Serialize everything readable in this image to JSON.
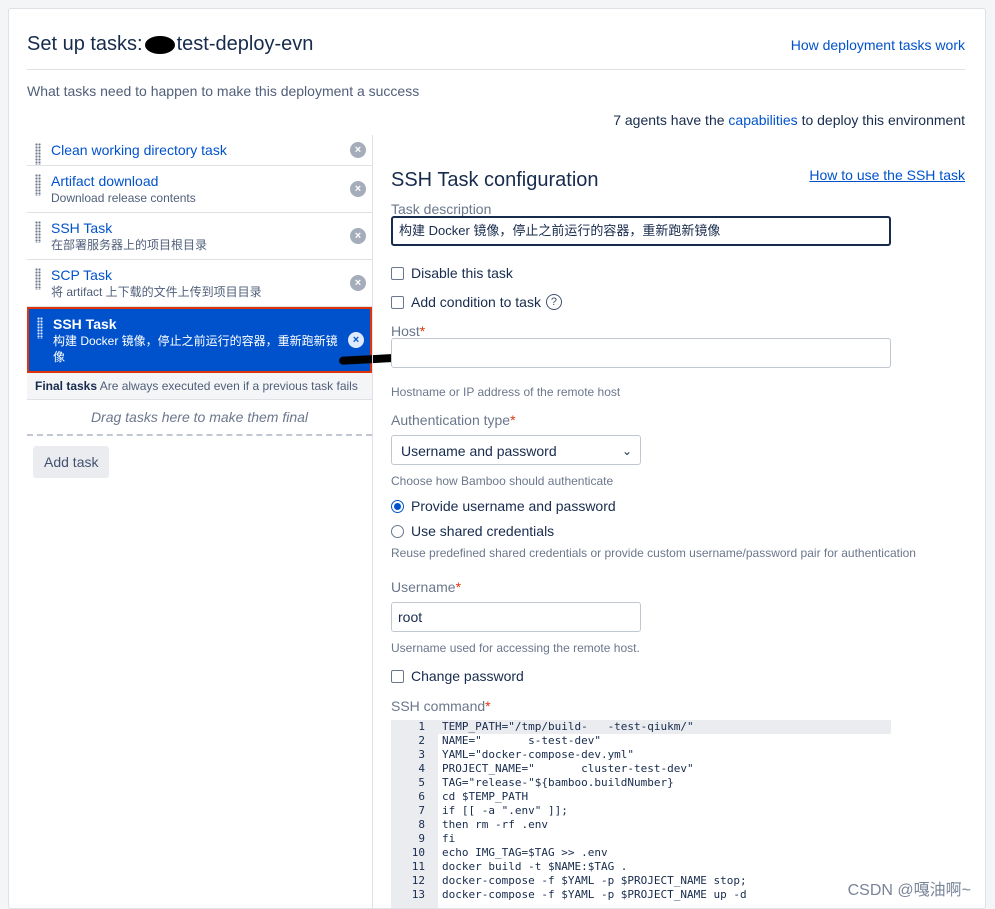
{
  "header": {
    "title_prefix": "Set up tasks:",
    "title_suffix": "test-deploy-evn",
    "help_link": "How deployment tasks work",
    "description": "What tasks need to happen to make this deployment a success",
    "agents_prefix": "7 agents have the",
    "agents_link": "capabilities",
    "agents_suffix": "to deploy this environment"
  },
  "tasks": [
    {
      "name": "Clean working directory task",
      "sub": ""
    },
    {
      "name": "Artifact download",
      "sub": "Download release contents"
    },
    {
      "name": "SSH Task",
      "sub": "在部署服务器上的项目根目录"
    },
    {
      "name": "SCP Task",
      "sub": "将 artifact 上下载的文件上传到项目目录"
    },
    {
      "name": "SSH Task",
      "sub": "构建 Docker 镜像，停止之前运行的容器，重新跑新镜像"
    }
  ],
  "final_tasks": {
    "bold": "Final tasks",
    "text": "Are always executed even if a previous task fails"
  },
  "drop_hint": "Drag tasks here to make them final",
  "add_task_label": "Add task",
  "config": {
    "title": "SSH Task configuration",
    "help_link": "How to use the SSH task",
    "task_description_label": "Task description",
    "task_description_value": "构建 Docker 镜像，停止之前运行的容器，重新跑新镜像",
    "disable_label": "Disable this task",
    "condition_label": "Add condition to task",
    "host_label": "Host",
    "host_value": "",
    "host_hint": "Hostname or IP address of the remote host",
    "auth_label": "Authentication type",
    "auth_value": "Username and password",
    "auth_hint": "Choose how Bamboo should authenticate",
    "radio_provide": "Provide username and password",
    "radio_shared": "Use shared credentials",
    "shared_hint": "Reuse predefined shared credentials or provide custom username/password pair for authentication",
    "username_label": "Username",
    "username_value": "root",
    "username_hint": "Username used for accessing the remote host.",
    "change_password_label": "Change password",
    "ssh_command_label": "SSH command"
  },
  "code_lines": [
    "TEMP_PATH=\"/tmp/build-   -test-qiukm/\"",
    "NAME=\"       s-test-dev\"",
    "YAML=\"docker-compose-dev.yml\"",
    "PROJECT_NAME=\"       cluster-test-dev\"",
    "TAG=\"release-\"${bamboo.buildNumber}",
    "cd $TEMP_PATH",
    "if [[ -a \".env\" ]];",
    "then rm -rf .env",
    "fi",
    "echo IMG_TAG=$TAG >> .env",
    "docker build -t $NAME:$TAG .",
    "docker-compose -f $YAML -p $PROJECT_NAME stop;",
    "docker-compose -f $YAML -p $PROJECT_NAME up -d"
  ],
  "watermark": "CSDN @嘎油啊~"
}
